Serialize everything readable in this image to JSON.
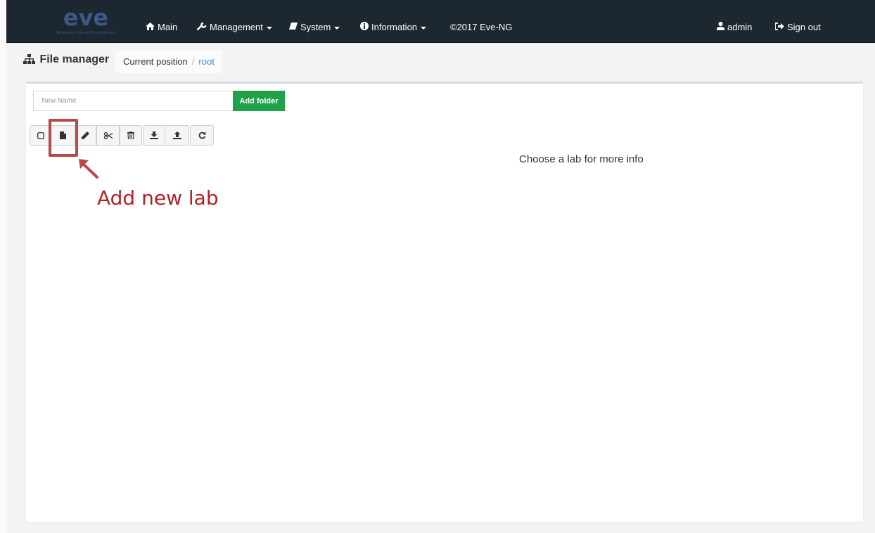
{
  "navbar": {
    "logo_text": "eve",
    "logo_subtext": "Emulated Virtual Environment",
    "items": [
      {
        "label": "Main",
        "icon": "home-icon"
      },
      {
        "label": "Management",
        "icon": "wrench-icon"
      },
      {
        "label": "System",
        "icon": "book-icon"
      },
      {
        "label": "Information",
        "icon": "info-icon"
      },
      {
        "label": "©2017 Eve-NG"
      }
    ],
    "user": {
      "label": "admin",
      "icon": "user-icon"
    },
    "signout": {
      "label": "Sign out",
      "icon": "sign-out-icon"
    }
  },
  "header": {
    "title": "File manager",
    "breadcrumb_label": "Current position",
    "breadcrumb_separator": "/",
    "breadcrumb_current": "root"
  },
  "folder_form": {
    "placeholder": "New Name",
    "value": "",
    "add_button": "Add folder"
  },
  "toolbar": {
    "buttons": [
      "checkbox-icon",
      "new-file-icon",
      "pencil-icon",
      "scissors-icon",
      "trash-icon",
      "download-icon",
      "upload-icon",
      "refresh-icon"
    ]
  },
  "info_panel": {
    "text": "Choose a lab for more info"
  },
  "annotation": {
    "text": "Add new lab",
    "color": "#b52026"
  },
  "colors": {
    "navbar_bg": "#1c2730",
    "add_button_bg": "#1fa24a",
    "link": "#3a8fd0"
  }
}
